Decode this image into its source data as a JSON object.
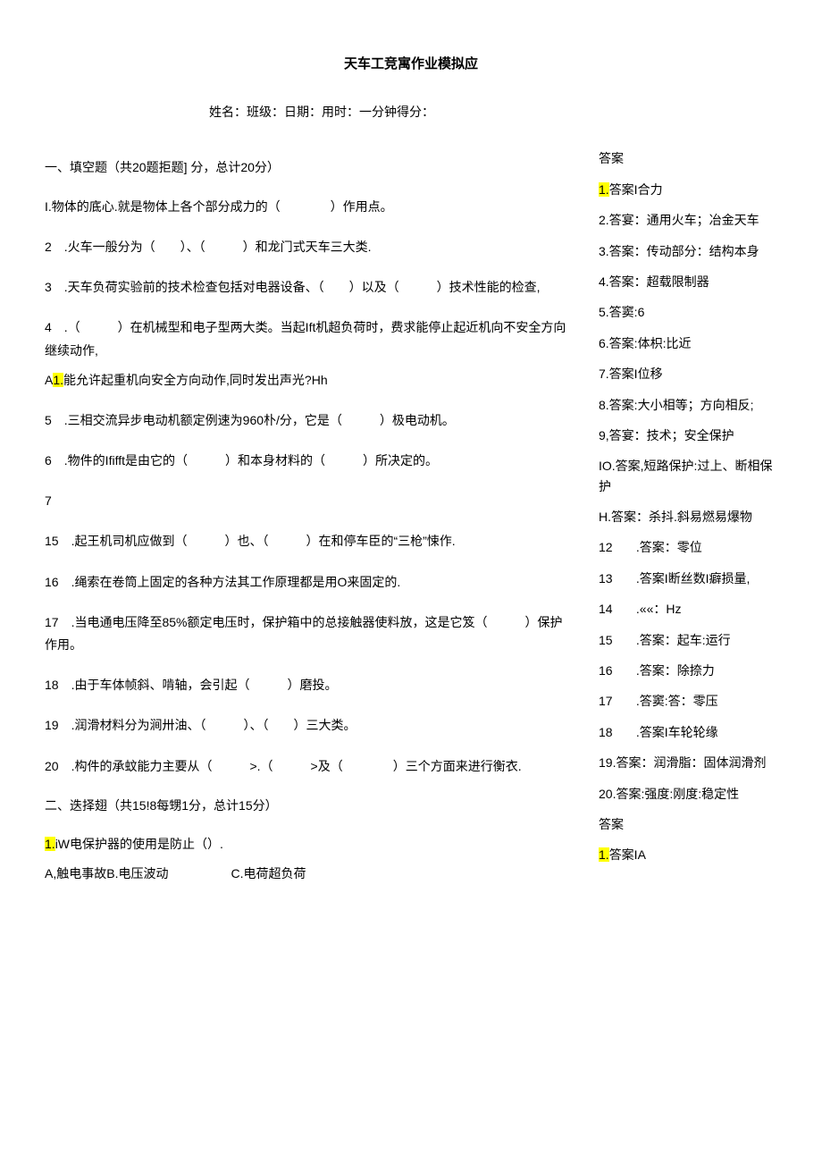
{
  "title": "天车工竞寓作业模拟应",
  "meta": "姓名：班级：日期：用时：一分钟得分：",
  "section1_head": "一、填空题（共20题拒题] 分，总计20分）",
  "section2_head": "二、迭择翅（共15!8每甥1分，总计15分）",
  "q1": "I.物体的底心.就是物体上各个部分成力的（　　　　）作用点。",
  "q2": "2　.火车一般分为（　　）、（　　　）和龙门式天车三大类.",
  "q3": "3　.天车负荷实验前的技术检查包括对电器设备、（　　）以及（　　　）技术性能的检查,",
  "q4a": "4　.（　　　）在机械型和电子型两大类。当起Ift机超负荷时，费求能停止起近机向不安全方向继续动作,",
  "q4b_pre": "A",
  "q4b_hl": "1.",
  "q4b_post": "能允许起重机向安全方向动作,同时发出声光?Hh",
  "q5": "5　.三相交流异步电动机额定例速为960朴/分，它是（　　　）极电动机。",
  "q6": "6　.物件的Ififft是由它的（　　　）和本身材料的（　　　）所决定的。",
  "q7": "7",
  "q15": "15　.起王机司机应做到（　　　）也、（　　　）在和停车臣的“三枪”悚作.",
  "q16": "16　.绳索在卷筒上固定的各种方法其工作原理都是用O来固定的.",
  "q17": "17　.当电通电压降至85%额定电压时，保护箱中的总接触器使料放，这是它笈（　　　）保护作用。",
  "q18": "18　.由于车体帧斜、啃轴，会引起（　　　）磨投。",
  "q19": "19　.润滑材料分为涧卅油、（　　　）、（　　）三大类。",
  "q20": "20　.构件的承蚊能力主要从（　　　>.（　　　>及（　　　　）三个方面来进行衡衣.",
  "mcq1_hl": "1.",
  "mcq1_post": "iW电保护器的使用是防止（）.",
  "mcq1_opts": "A,触电事故B.电压波动　　　　　C.电荷超负荷",
  "ans_head": "答案",
  "a1_hl": "1.",
  "a1": "答案I合力",
  "a2": "2.答宴：通用火车；冶金天车",
  "a3": "3.答案：传动部分：结构本身",
  "a4": "4.答案：超载限制器",
  "a5": "5.答窦:6",
  "a6": "6.答案:体枳:比近",
  "a7": "7.答案I位移",
  "a8": "8.答案:大小相等；方向相反;",
  "a9": "9,答宴：技术；安全保护",
  "a10": "IO.答案,短路保护:过上、断相保护",
  "a11": "H.答案：杀抖.斜易燃易爆物",
  "a12n": "12",
  "a12t": ".答案：零位",
  "a13n": "13",
  "a13t": ".答案I断丝数I癖损量,",
  "a13t2": "量,",
  "a14n": "14",
  "a14t": ".««：Hz",
  "a15n": "15",
  "a15t": ".答案：起车:运行",
  "a16n": "16",
  "a16t": ".答案：除捺力",
  "a17n": "17",
  "a17t": ".答窦:答：零压",
  "a18n": "18",
  "a18t": ".答案I车轮轮缘",
  "a19": "19.答案：润滑脂：固体润滑剂",
  "a20": "20.答案:强度:刚度:稳定性",
  "ans_head2": "答案",
  "b1_hl": "1.",
  "b1": "答案IA"
}
